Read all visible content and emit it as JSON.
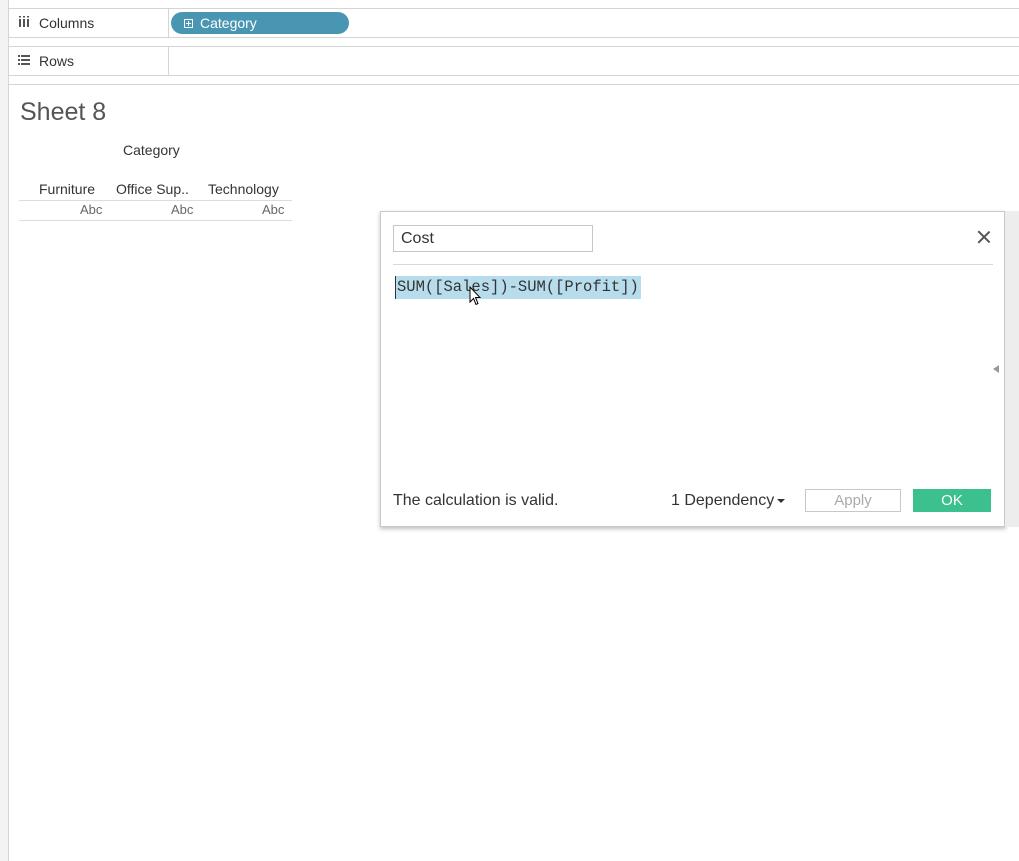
{
  "shelves": {
    "columns": {
      "label": "Columns",
      "icon": "columns-icon",
      "pill": "Category"
    },
    "rows": {
      "label": "Rows",
      "icon": "rows-icon"
    }
  },
  "sheet": {
    "title": "Sheet 8",
    "header_title": "Category",
    "columns": [
      "Furniture",
      "Office Sup..",
      "Technology"
    ],
    "values": [
      "Abc",
      "Abc",
      "Abc"
    ]
  },
  "dialog": {
    "name": "Cost",
    "formula": "SUM([Sales])-SUM([Profit])",
    "status": "The calculation is valid.",
    "dependency": "1 Dependency",
    "apply_label": "Apply",
    "ok_label": "OK"
  },
  "colors": {
    "pill": "#4996b2",
    "selection": "#b7dceb",
    "ok": "#3cc08e"
  }
}
